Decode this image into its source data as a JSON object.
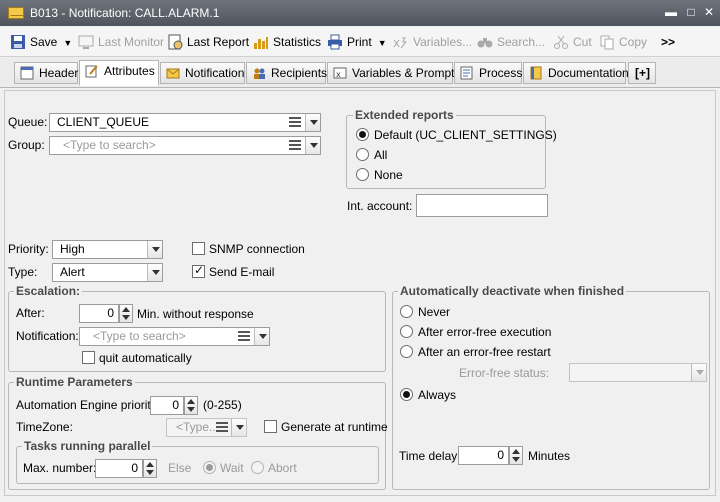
{
  "window": {
    "title": "B013 - Notification: CALL.ALARM.1",
    "min": "▬",
    "max": "□",
    "close": "✕"
  },
  "toolbar": {
    "save": "Save",
    "last_monitor": "Last Monitor",
    "last_report": "Last Report",
    "statistics": "Statistics",
    "print": "Print",
    "variables": "Variables...",
    "search": "Search...",
    "cut": "Cut",
    "copy": "Copy",
    "more": ">>"
  },
  "tabs": [
    "Header",
    "Attributes",
    "Notification",
    "Recipients",
    "Variables & Prompts",
    "Process",
    "Documentation",
    "[+]"
  ],
  "queue": {
    "label": "Queue:",
    "value": "CLIENT_QUEUE"
  },
  "group": {
    "label": "Group:",
    "placeholder": "<Type to search>"
  },
  "extended_reports": {
    "title": "Extended reports",
    "options": [
      "Default (UC_CLIENT_SETTINGS)",
      "All",
      "None"
    ],
    "selected": 0
  },
  "int_account": {
    "label": "Int. account:",
    "value": ""
  },
  "priority": {
    "label": "Priority:",
    "value": "High"
  },
  "type": {
    "label": "Type:",
    "value": "Alert"
  },
  "snmp": {
    "label": "SNMP connection",
    "checked": false
  },
  "send_email": {
    "label": "Send E-mail",
    "checked": true
  },
  "escalation": {
    "title": "Escalation:",
    "after_label": "After:",
    "after_value": "0",
    "after_unit": "Min. without response",
    "notification_label": "Notification:",
    "notification_placeholder": "<Type to search>",
    "quit_label": "quit automatically"
  },
  "runtime": {
    "title": "Runtime Parameters",
    "ae_priority_label": "Automation Engine priority:",
    "ae_priority_value": "0",
    "ae_range": "(0-255)",
    "timezone_label": "TimeZone:",
    "timezone_placeholder": "<Type...",
    "generate_label": "Generate at runtime",
    "parallel_title": "Tasks running parallel",
    "max_label": "Max. number:",
    "max_value": "0",
    "else_label": "Else",
    "wait_label": "Wait",
    "abort_label": "Abort"
  },
  "deactivate": {
    "title": "Automatically deactivate when finished",
    "options": [
      "Never",
      "After error-free execution",
      "After an error-free restart"
    ],
    "error_free_status_label": "Error-free status:",
    "always_label": "Always",
    "time_delay_label": "Time delay:",
    "time_delay_value": "0",
    "time_delay_unit": "Minutes"
  }
}
